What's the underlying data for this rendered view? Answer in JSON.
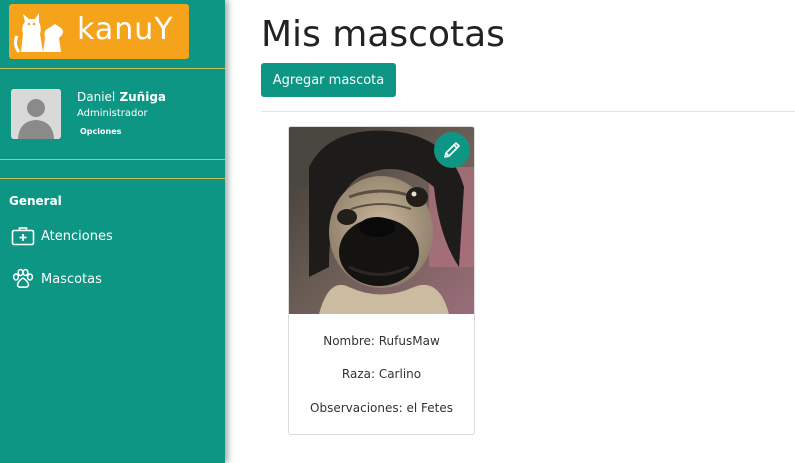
{
  "brand": {
    "logo_text": "kanuY",
    "accent": "#0e9684",
    "logo_bg": "#f5a31a"
  },
  "user": {
    "first_name": "Daniel",
    "last_name": "Zuñiga",
    "role": "Administrador",
    "options_label": "Opciones"
  },
  "sidebar": {
    "section_title": "General",
    "items": [
      {
        "label": "Atenciones",
        "icon": "medical-kit-icon"
      },
      {
        "label": "Mascotas",
        "icon": "paw-icon"
      }
    ]
  },
  "main": {
    "title": "Mis mascotas",
    "add_button_label": "Agregar mascota"
  },
  "pets": [
    {
      "name_line": "Nombre: RufusMaw",
      "breed_line": "Raza: Carlino",
      "notes_line": "Observaciones: el Fetes",
      "edit_icon": "pencil-icon"
    }
  ]
}
